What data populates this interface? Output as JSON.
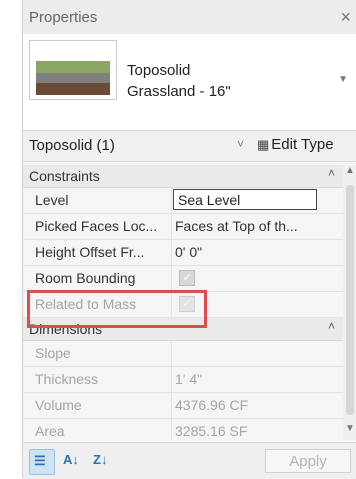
{
  "panel": {
    "title": "Properties",
    "close_label": "×"
  },
  "type": {
    "name_line1": "Toposolid",
    "name_line2": "Grassland - 16\"",
    "arrow": "▼",
    "swatch_colors": {
      "top": "#8aa663",
      "middle": "#7f7f7f",
      "bottom": "#6a4b37"
    }
  },
  "selector": {
    "label": "Toposolid (1)",
    "chevron": "˅",
    "edit_type_icon": "▦",
    "edit_type_label": "Edit Type"
  },
  "groups": {
    "constraints": {
      "label": "Constraints",
      "collapse": "˄"
    },
    "dimensions": {
      "label": "Dimensions",
      "collapse": "˄"
    }
  },
  "properties": {
    "level": {
      "key": "Level",
      "value": "Sea Level"
    },
    "picked_faces": {
      "key": "Picked Faces Loc...",
      "value": "Faces at Top of th..."
    },
    "height_offset": {
      "key": "Height Offset Fr...",
      "value": "0' 0\""
    },
    "room_bounding": {
      "key": "Room Bounding",
      "check": "✓"
    },
    "related_to_mass": {
      "key": "Related to Mass",
      "check": "✓"
    },
    "slope": {
      "key": "Slope",
      "value": ""
    },
    "thickness": {
      "key": "Thickness",
      "value": "1' 4\""
    },
    "volume": {
      "key": "Volume",
      "value": "4376.96 CF"
    },
    "area": {
      "key": "Area",
      "value": "3285.16 SF"
    }
  },
  "footer": {
    "categorized_glyph": "☰",
    "sort_az_glyph": "A↓",
    "sort_za_glyph": "Z↓",
    "apply_label": "Apply"
  },
  "colors": {
    "highlight": "#e04c4c",
    "active_button": "#cfe3f6"
  }
}
